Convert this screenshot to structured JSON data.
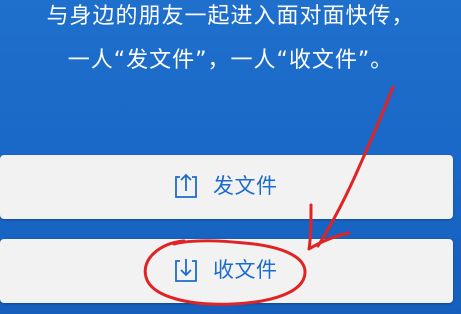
{
  "intro": {
    "line1": "与身边的朋友一起进入面对面快传，",
    "line2": "一人“发文件”，一人“收文件”。"
  },
  "actions": {
    "send_label": "发文件",
    "receive_label": "收文件"
  },
  "icons": {
    "send": "upload-icon",
    "receive": "download-icon"
  },
  "colors": {
    "background": "#1a68c8",
    "button_bg": "#f2f2f2",
    "accent": "#1c6ccc",
    "annotation": "#e02424"
  }
}
